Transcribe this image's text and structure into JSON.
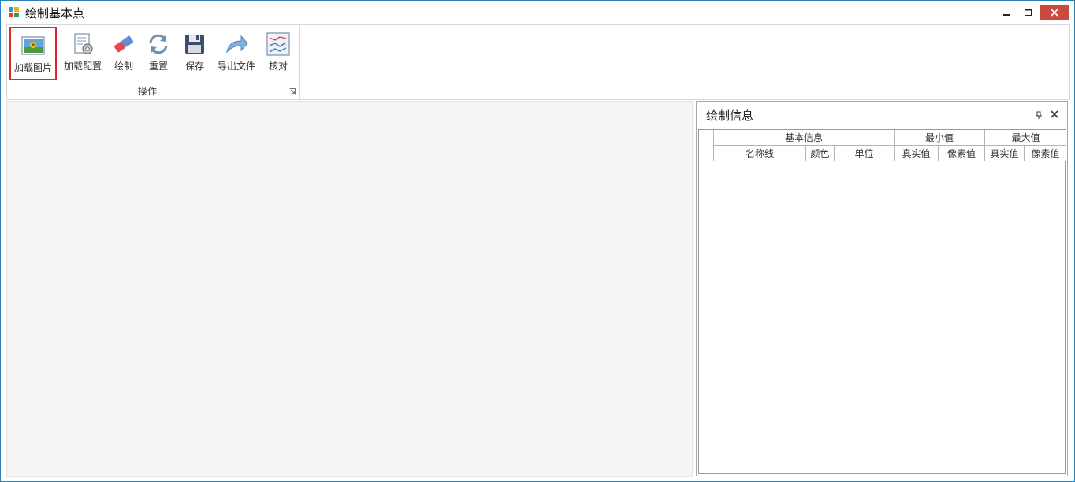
{
  "window": {
    "title": "绘制基本点",
    "controls": {
      "minimize": "minimize-icon",
      "maximize": "maximize-icon",
      "close": "close-icon"
    }
  },
  "ribbon": {
    "group_label": "操作",
    "buttons": [
      {
        "label": "加载图片",
        "icon": "image-icon",
        "selected": true
      },
      {
        "label": "加载配置",
        "icon": "config-gear-icon"
      },
      {
        "label": "绘制",
        "icon": "eraser-icon"
      },
      {
        "label": "重置",
        "icon": "refresh-icon"
      },
      {
        "label": "保存",
        "icon": "save-icon"
      },
      {
        "label": "导出文件",
        "icon": "export-arrow-icon"
      },
      {
        "label": "核对",
        "icon": "chart-check-icon"
      }
    ]
  },
  "panel": {
    "title": "绘制信息",
    "grid": {
      "group_headers": [
        "基本信息",
        "最小值",
        "最大值"
      ],
      "column_headers": [
        "名称线",
        "颜色",
        "单位",
        "真实值",
        "像素值",
        "真实值",
        "像素值"
      ],
      "rows": []
    }
  },
  "colors": {
    "accent_border": "#2b7fb8",
    "close_button": "#c94b3f",
    "selection": "#e2242b"
  }
}
